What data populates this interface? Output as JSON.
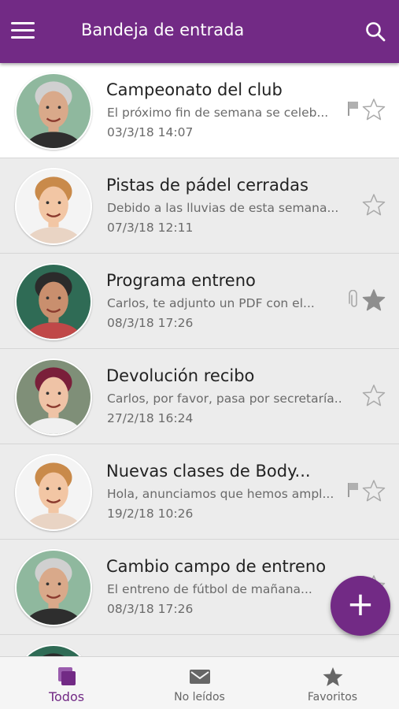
{
  "header": {
    "title": "Bandeja de entrada",
    "menu_icon": "hamburger-menu-icon",
    "search_icon": "search-icon"
  },
  "colors": {
    "primary": "#722a85",
    "unread_row": "#ffffff",
    "read_row": "#ececec"
  },
  "messages": [
    {
      "subject": "Campeonato del club",
      "preview": "El próximo fin de semana se celeb...",
      "date": "03/3/18  14:07",
      "unread": true,
      "flag": true,
      "attachment": false,
      "starred": false
    },
    {
      "subject": "Pistas de pádel cerradas",
      "preview": "Debido a las lluvias de esta semana...",
      "date": "07/3/18  12:11",
      "unread": false,
      "flag": false,
      "attachment": false,
      "starred": false
    },
    {
      "subject": "Programa entreno",
      "preview": "Carlos, te adjunto un PDF con el...",
      "date": "08/3/18  17:26",
      "unread": false,
      "flag": false,
      "attachment": true,
      "starred": true
    },
    {
      "subject": "Devolución recibo",
      "preview": "Carlos, por favor, pasa por secretaría...",
      "date": "27/2/18  16:24",
      "unread": false,
      "flag": false,
      "attachment": false,
      "starred": false
    },
    {
      "subject": "Nuevas clases de Body...",
      "preview": "Hola, anunciamos que hemos ampl...",
      "date": "19/2/18  10:26",
      "unread": false,
      "flag": true,
      "attachment": false,
      "starred": false
    },
    {
      "subject": "Cambio campo de entreno",
      "preview": "El entreno de fútbol de mañana...",
      "date": "08/3/18  17:26",
      "unread": false,
      "flag": false,
      "attachment": false,
      "starred": false
    },
    {
      "subject": "",
      "preview": "",
      "date": "",
      "unread": false,
      "flag": false,
      "attachment": false,
      "starred": false
    }
  ],
  "fab": {
    "label": "+"
  },
  "bottom_nav": [
    {
      "label": "Todos",
      "icon": "all-messages-icon",
      "active": true
    },
    {
      "label": "No leídos",
      "icon": "envelope-icon",
      "active": false
    },
    {
      "label": "Favoritos",
      "icon": "star-icon",
      "active": false
    }
  ]
}
